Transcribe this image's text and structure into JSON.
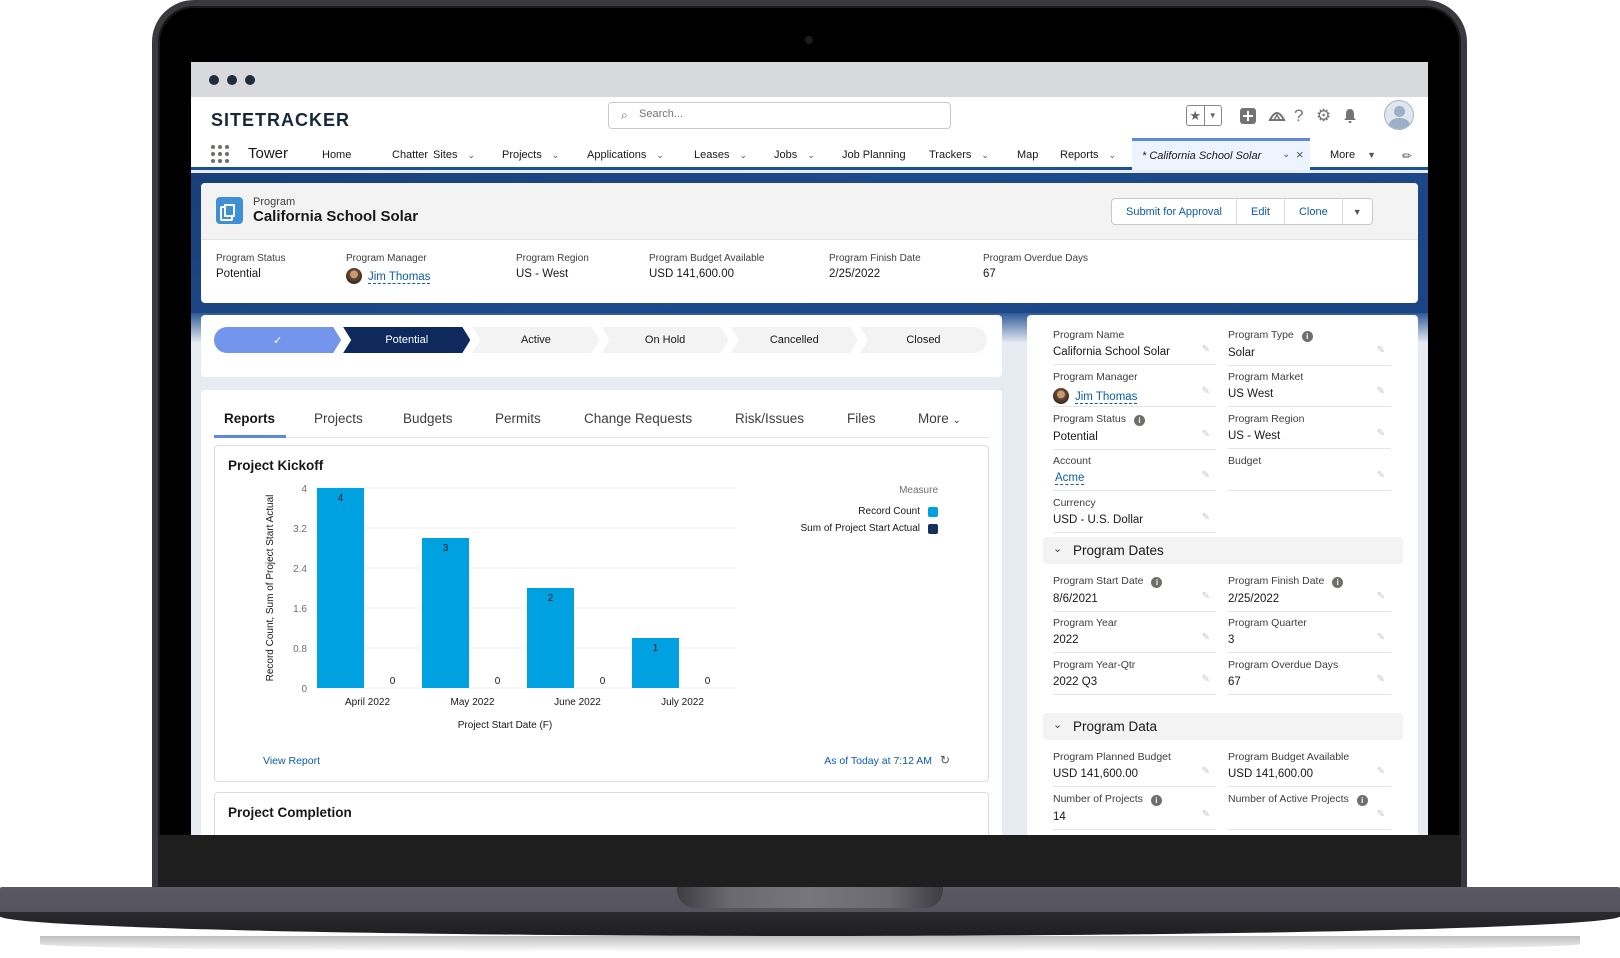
{
  "browser": {
    "window_dots": 3
  },
  "header": {
    "logo": "SITETRACKER",
    "search_placeholder": "Search...",
    "icons": [
      "favorites-star-icon",
      "global-add-icon",
      "trailhead-icon",
      "help-icon",
      "setup-gear-icon",
      "notifications-bell-icon",
      "user-avatar"
    ]
  },
  "nav": {
    "app_name": "Tower",
    "items": [
      {
        "label": "Home",
        "dropdown": false
      },
      {
        "label": "Chatter",
        "dropdown": false
      },
      {
        "label": "Sites",
        "dropdown": true
      },
      {
        "label": "Projects",
        "dropdown": true
      },
      {
        "label": "Applications",
        "dropdown": true
      },
      {
        "label": "Leases",
        "dropdown": true
      },
      {
        "label": "Jobs",
        "dropdown": true
      },
      {
        "label": "Job Planning",
        "dropdown": false
      },
      {
        "label": "Trackers",
        "dropdown": true
      },
      {
        "label": "Map",
        "dropdown": false
      },
      {
        "label": "Reports",
        "dropdown": true
      }
    ],
    "active_tab": "* California School Solar",
    "more_label": "More"
  },
  "record": {
    "object_type": "Program",
    "title": "California School Solar",
    "actions": [
      "Submit for Approval",
      "Edit",
      "Clone"
    ],
    "highlights": [
      {
        "label": "Program Status",
        "value": "Potential"
      },
      {
        "label": "Program Manager",
        "value": "Jim Thomas",
        "link": true
      },
      {
        "label": "Program Region",
        "value": "US - West"
      },
      {
        "label": "Program Budget Available",
        "value": "USD 141,600.00"
      },
      {
        "label": "Program Finish Date",
        "value": "2/25/2022"
      },
      {
        "label": "Program Overdue Days",
        "value": "67"
      }
    ]
  },
  "path": {
    "stages": [
      {
        "label": "✓",
        "state": "complete"
      },
      {
        "label": "Potential",
        "state": "current"
      },
      {
        "label": "Active",
        "state": "incomplete"
      },
      {
        "label": "On Hold",
        "state": "incomplete"
      },
      {
        "label": "Cancelled",
        "state": "incomplete"
      },
      {
        "label": "Closed",
        "state": "incomplete"
      }
    ]
  },
  "tabs": {
    "items": [
      "Reports",
      "Projects",
      "Budgets",
      "Permits",
      "Change Requests",
      "Risk/Issues",
      "Files",
      "More"
    ],
    "active": "Reports"
  },
  "reports": [
    {
      "title": "Project Kickoff",
      "view_report_label": "View Report",
      "as_of": "As of Today at 7:12 AM"
    },
    {
      "title": "Project Completion"
    }
  ],
  "chart_data": {
    "type": "bar",
    "title": "Project Kickoff",
    "categories": [
      "April 2022",
      "May 2022",
      "June 2022",
      "July 2022"
    ],
    "series": [
      {
        "name": "Record Count",
        "values": [
          4,
          3,
          2,
          1
        ],
        "color": "#00a1e0"
      },
      {
        "name": "Sum of Project Start Actual",
        "values": [
          0,
          0,
          0,
          0
        ],
        "color": "#16325c"
      }
    ],
    "xlabel": "Project Start Date (F)",
    "ylabel": "Record Count, Sum of Project Start Actual",
    "yticks": [
      "0",
      "0.8",
      "1.6",
      "2.4",
      "3.2",
      "4"
    ],
    "ylim": [
      0,
      4
    ],
    "grid": true,
    "legend_title": "Measure",
    "legend_position": "top-right"
  },
  "details": {
    "fields": [
      {
        "label": "Program Name",
        "value": "California School Solar",
        "info": false
      },
      {
        "label": "Program Type",
        "value": "Solar",
        "info": true
      },
      {
        "label": "Program Manager",
        "value": "Jim Thomas",
        "link": true,
        "info": false
      },
      {
        "label": "Program Market",
        "value": "US West",
        "info": false
      },
      {
        "label": "Program Status",
        "value": "Potential",
        "info": true
      },
      {
        "label": "Program Region",
        "value": "US - West",
        "info": false
      },
      {
        "label": "Account",
        "value": "Acme",
        "link": true,
        "info": false
      },
      {
        "label": "Budget",
        "value": "",
        "info": false
      },
      {
        "label": "Currency",
        "value": "USD - U.S. Dollar",
        "info": false
      }
    ],
    "sections": [
      {
        "title": "Program Dates",
        "fields": [
          {
            "label": "Program Start Date",
            "value": "8/6/2021",
            "info": true
          },
          {
            "label": "Program Finish Date",
            "value": "2/25/2022",
            "info": true
          },
          {
            "label": "Program Year",
            "value": "2022",
            "info": false
          },
          {
            "label": "Program Quarter",
            "value": "3",
            "info": false
          },
          {
            "label": "Program Year-Qtr",
            "value": "2022 Q3",
            "info": false
          },
          {
            "label": "Program Overdue Days",
            "value": "67",
            "info": false
          }
        ]
      },
      {
        "title": "Program Data",
        "fields": [
          {
            "label": "Program Planned Budget",
            "value": "USD 141,600.00",
            "info": false
          },
          {
            "label": "Program Budget Available",
            "value": "USD 141,600.00",
            "info": false
          },
          {
            "label": "Number of Projects",
            "value": "14",
            "info": true
          },
          {
            "label": "Number of Active Projects",
            "value": "",
            "info": true
          }
        ]
      }
    ]
  }
}
